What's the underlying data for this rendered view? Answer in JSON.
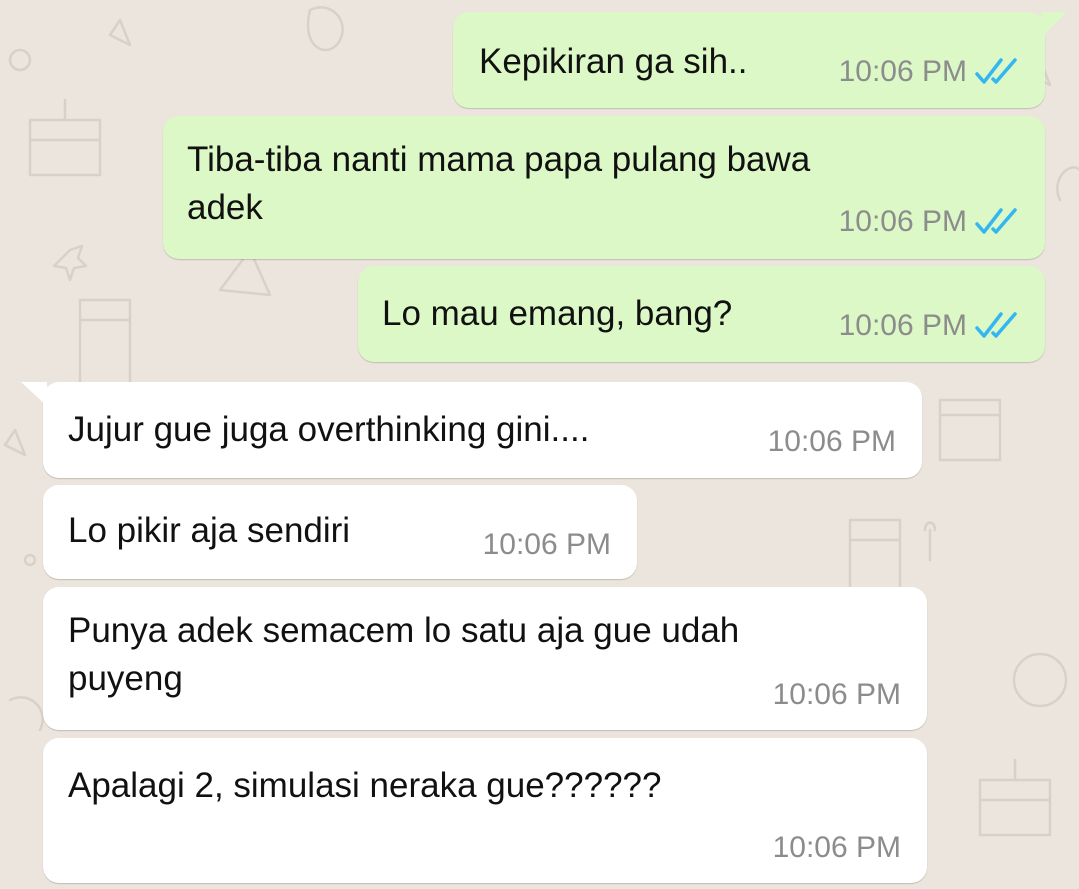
{
  "colors": {
    "background": "#ece5dd",
    "outgoing_bubble": "#dcf8c6",
    "incoming_bubble": "#ffffff",
    "read_ticks": "#34b7f1",
    "timestamp": "#8c8c8c"
  },
  "messages": [
    {
      "direction": "outgoing",
      "lines": [
        "Kepikiran ga sih.."
      ],
      "time": "10:06 PM",
      "status_icon": "double-check-read-icon"
    },
    {
      "direction": "outgoing",
      "lines": [
        "Tiba-tiba nanti mama papa pulang bawa",
        "adek"
      ],
      "time": "10:06 PM",
      "status_icon": "double-check-read-icon"
    },
    {
      "direction": "outgoing",
      "lines": [
        "Lo mau emang, bang?"
      ],
      "time": "10:06 PM",
      "status_icon": "double-check-read-icon"
    },
    {
      "direction": "incoming",
      "lines": [
        "Jujur gue juga overthinking gini...."
      ],
      "time": "10:06 PM"
    },
    {
      "direction": "incoming",
      "lines": [
        "Lo pikir aja sendiri"
      ],
      "time": "10:06 PM"
    },
    {
      "direction": "incoming",
      "lines": [
        "Punya adek semacem lo satu aja gue udah",
        "puyeng"
      ],
      "time": "10:06 PM"
    },
    {
      "direction": "incoming",
      "lines": [
        "Apalagi 2, simulasi neraka gue??????"
      ],
      "time": "10:06 PM"
    }
  ]
}
